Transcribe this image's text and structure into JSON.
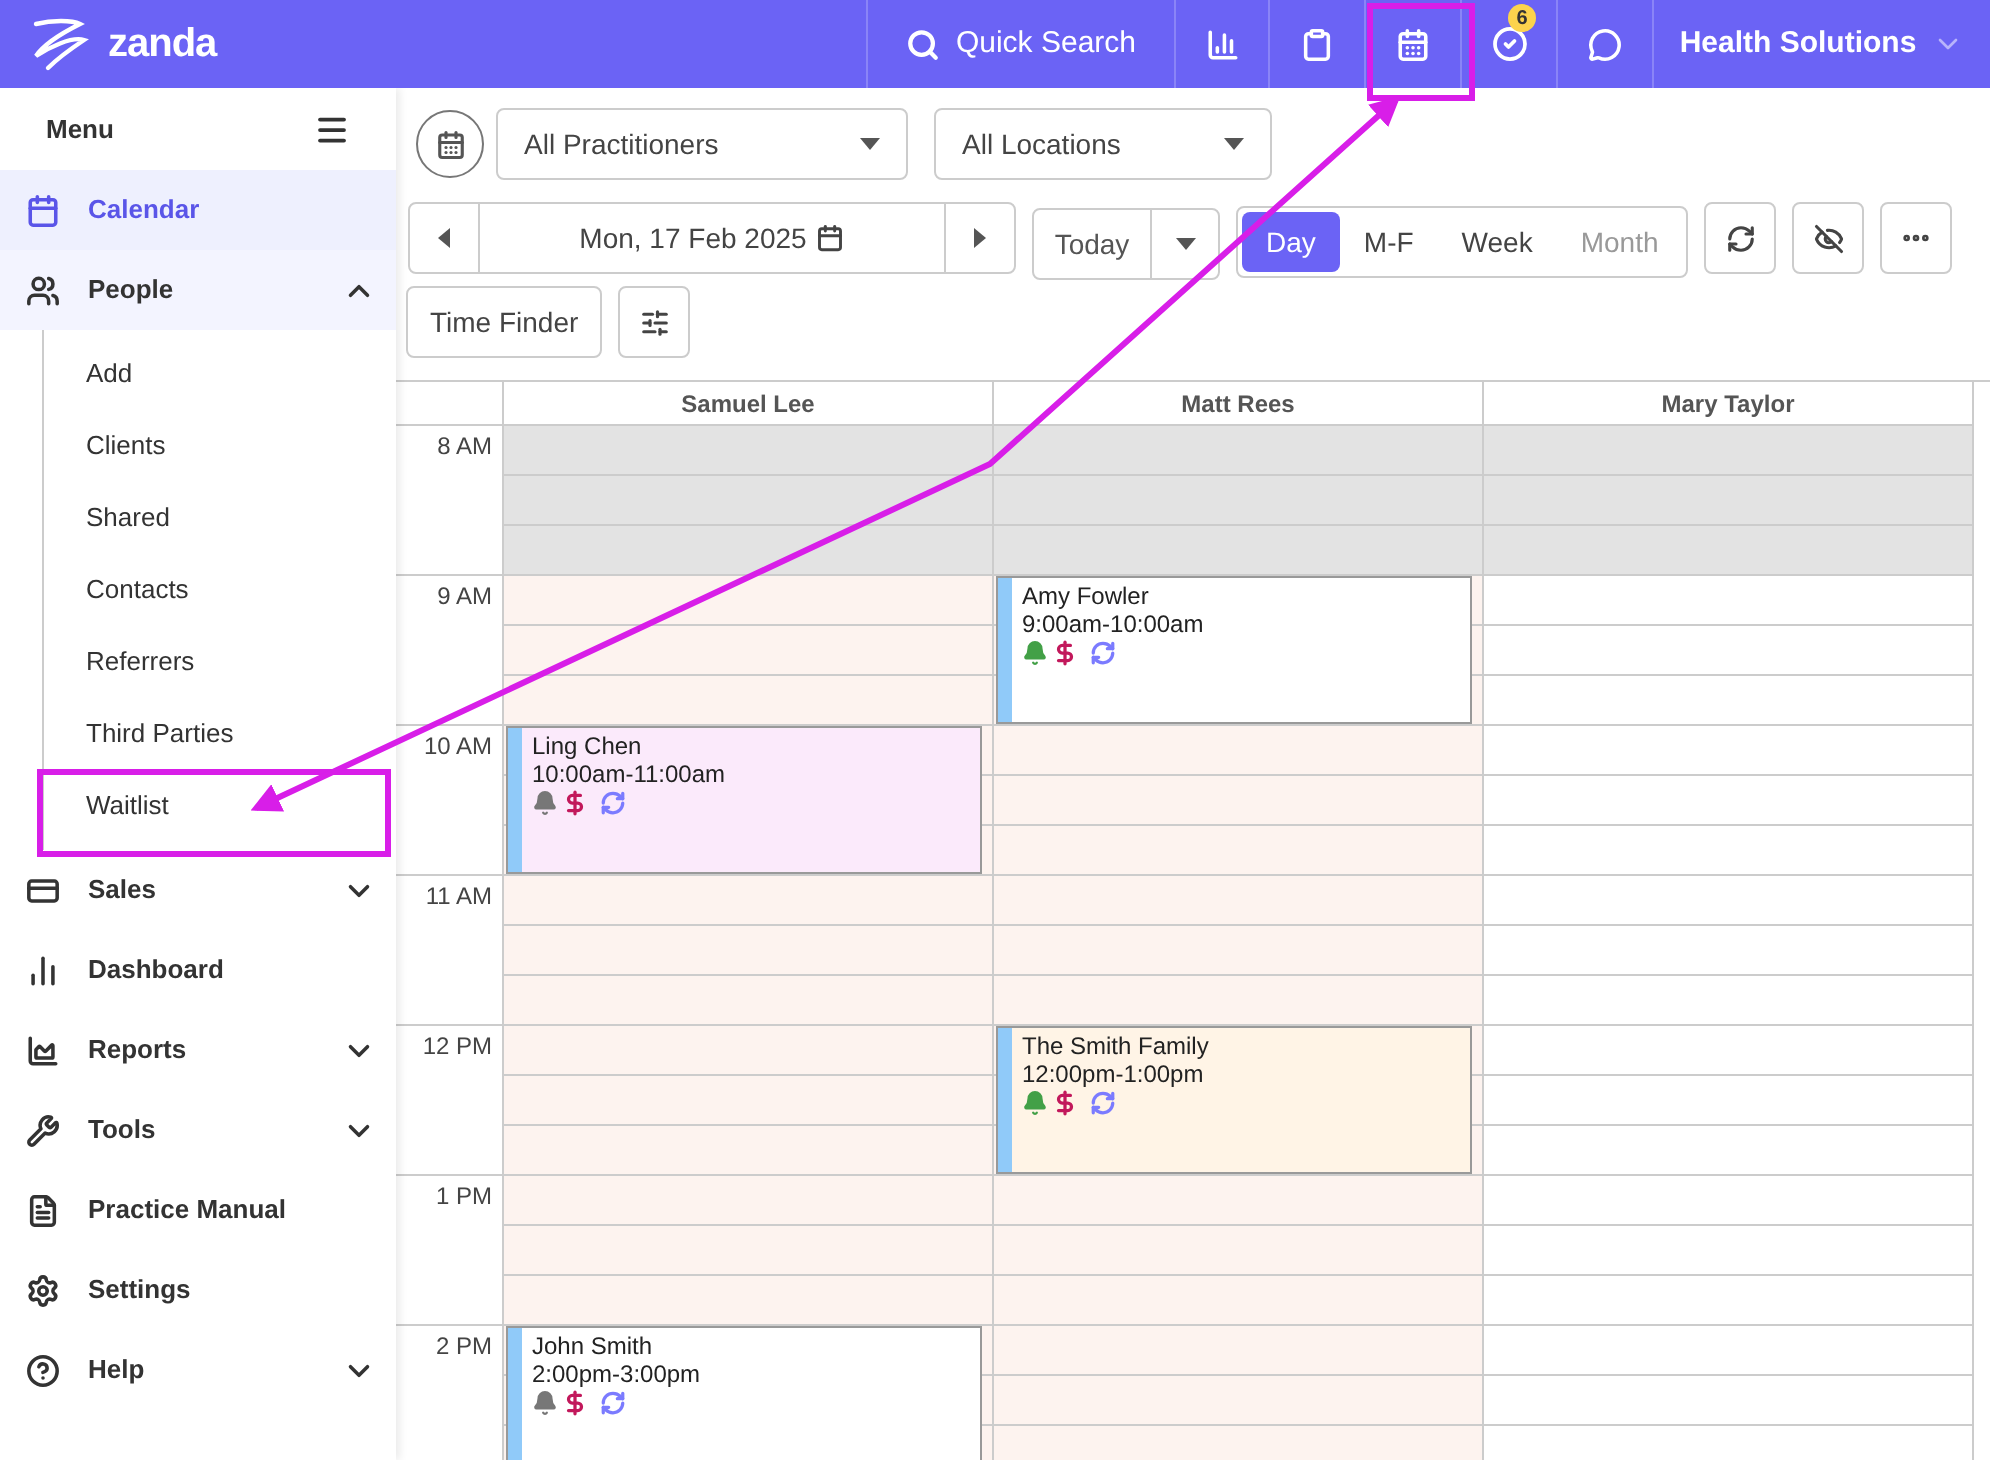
{
  "topbar": {
    "logo": "zanda",
    "search": "Quick Search",
    "notifications_badge": "6",
    "account": "Health Solutions"
  },
  "sidebar": {
    "title": "Menu",
    "items": [
      {
        "kind": "link",
        "label": "Calendar",
        "selected": true
      },
      {
        "kind": "group",
        "label": "People",
        "selected": false,
        "expanded": true,
        "children": [
          {
            "label": "Add",
            "selected": false
          },
          {
            "label": "Clients",
            "selected": false
          },
          {
            "label": "Shared",
            "selected": false
          },
          {
            "label": "Contacts",
            "selected": false
          },
          {
            "label": "Referrers",
            "selected": false
          },
          {
            "label": "Third Parties",
            "selected": false
          },
          {
            "label": "Waitlist",
            "selected": false
          }
        ]
      },
      {
        "kind": "group",
        "label": "Sales",
        "selected": false,
        "expanded": false
      },
      {
        "kind": "link",
        "label": "Dashboard",
        "selected": false
      },
      {
        "kind": "group",
        "label": "Reports",
        "selected": false,
        "expanded": false
      },
      {
        "kind": "group",
        "label": "Tools",
        "selected": false,
        "expanded": false
      },
      {
        "kind": "link",
        "label": "Practice Manual",
        "selected": false
      },
      {
        "kind": "link",
        "label": "Settings",
        "selected": false
      },
      {
        "kind": "group",
        "label": "Help",
        "selected": false,
        "expanded": false
      }
    ]
  },
  "toolbar": {
    "practitioners": "All Practitioners",
    "locations": "All Locations",
    "date": "Mon, 17 Feb 2025",
    "today": "Today",
    "views": [
      {
        "label": "Day",
        "selected": true,
        "disabled": false
      },
      {
        "label": "M-F",
        "selected": false,
        "disabled": false
      },
      {
        "label": "Week",
        "selected": false,
        "disabled": false
      },
      {
        "label": "Month",
        "selected": false,
        "disabled": true
      }
    ],
    "time_finder": "Time Finder"
  },
  "calendar": {
    "columns": [
      {
        "name": "Samuel Lee",
        "working": true
      },
      {
        "name": "Matt Rees",
        "working": true
      },
      {
        "name": "Mary Taylor",
        "working": false
      }
    ],
    "rows": [
      {
        "label": "8 AM",
        "unavailable": true,
        "cells": [
          null,
          null,
          null
        ]
      },
      {
        "label": "9 AM",
        "unavailable": false,
        "cells": [
          null,
          {
            "name": "Amy Fowler",
            "time": "9:00am-10:00am",
            "reminder_sent": true,
            "color": "#ffffff"
          },
          null
        ]
      },
      {
        "label": "10 AM",
        "unavailable": false,
        "cells": [
          {
            "name": "Ling Chen",
            "time": "10:00am-11:00am",
            "reminder_sent": false,
            "color": "#fbeafb"
          },
          null,
          null
        ]
      },
      {
        "label": "11 AM",
        "unavailable": false,
        "cells": [
          null,
          null,
          null
        ]
      },
      {
        "label": "12 PM",
        "unavailable": false,
        "cells": [
          null,
          {
            "name": "The Smith Family",
            "time": "12:00pm-1:00pm",
            "reminder_sent": true,
            "color": "#fff4e6"
          },
          null
        ]
      },
      {
        "label": "1 PM",
        "unavailable": false,
        "cells": [
          null,
          null,
          null
        ]
      },
      {
        "label": "2 PM",
        "unavailable": false,
        "cells": [
          {
            "name": "John Smith",
            "time": "2:00pm-3:00pm",
            "reminder_sent": false,
            "color": "#ffffff"
          },
          null,
          null
        ]
      }
    ]
  }
}
